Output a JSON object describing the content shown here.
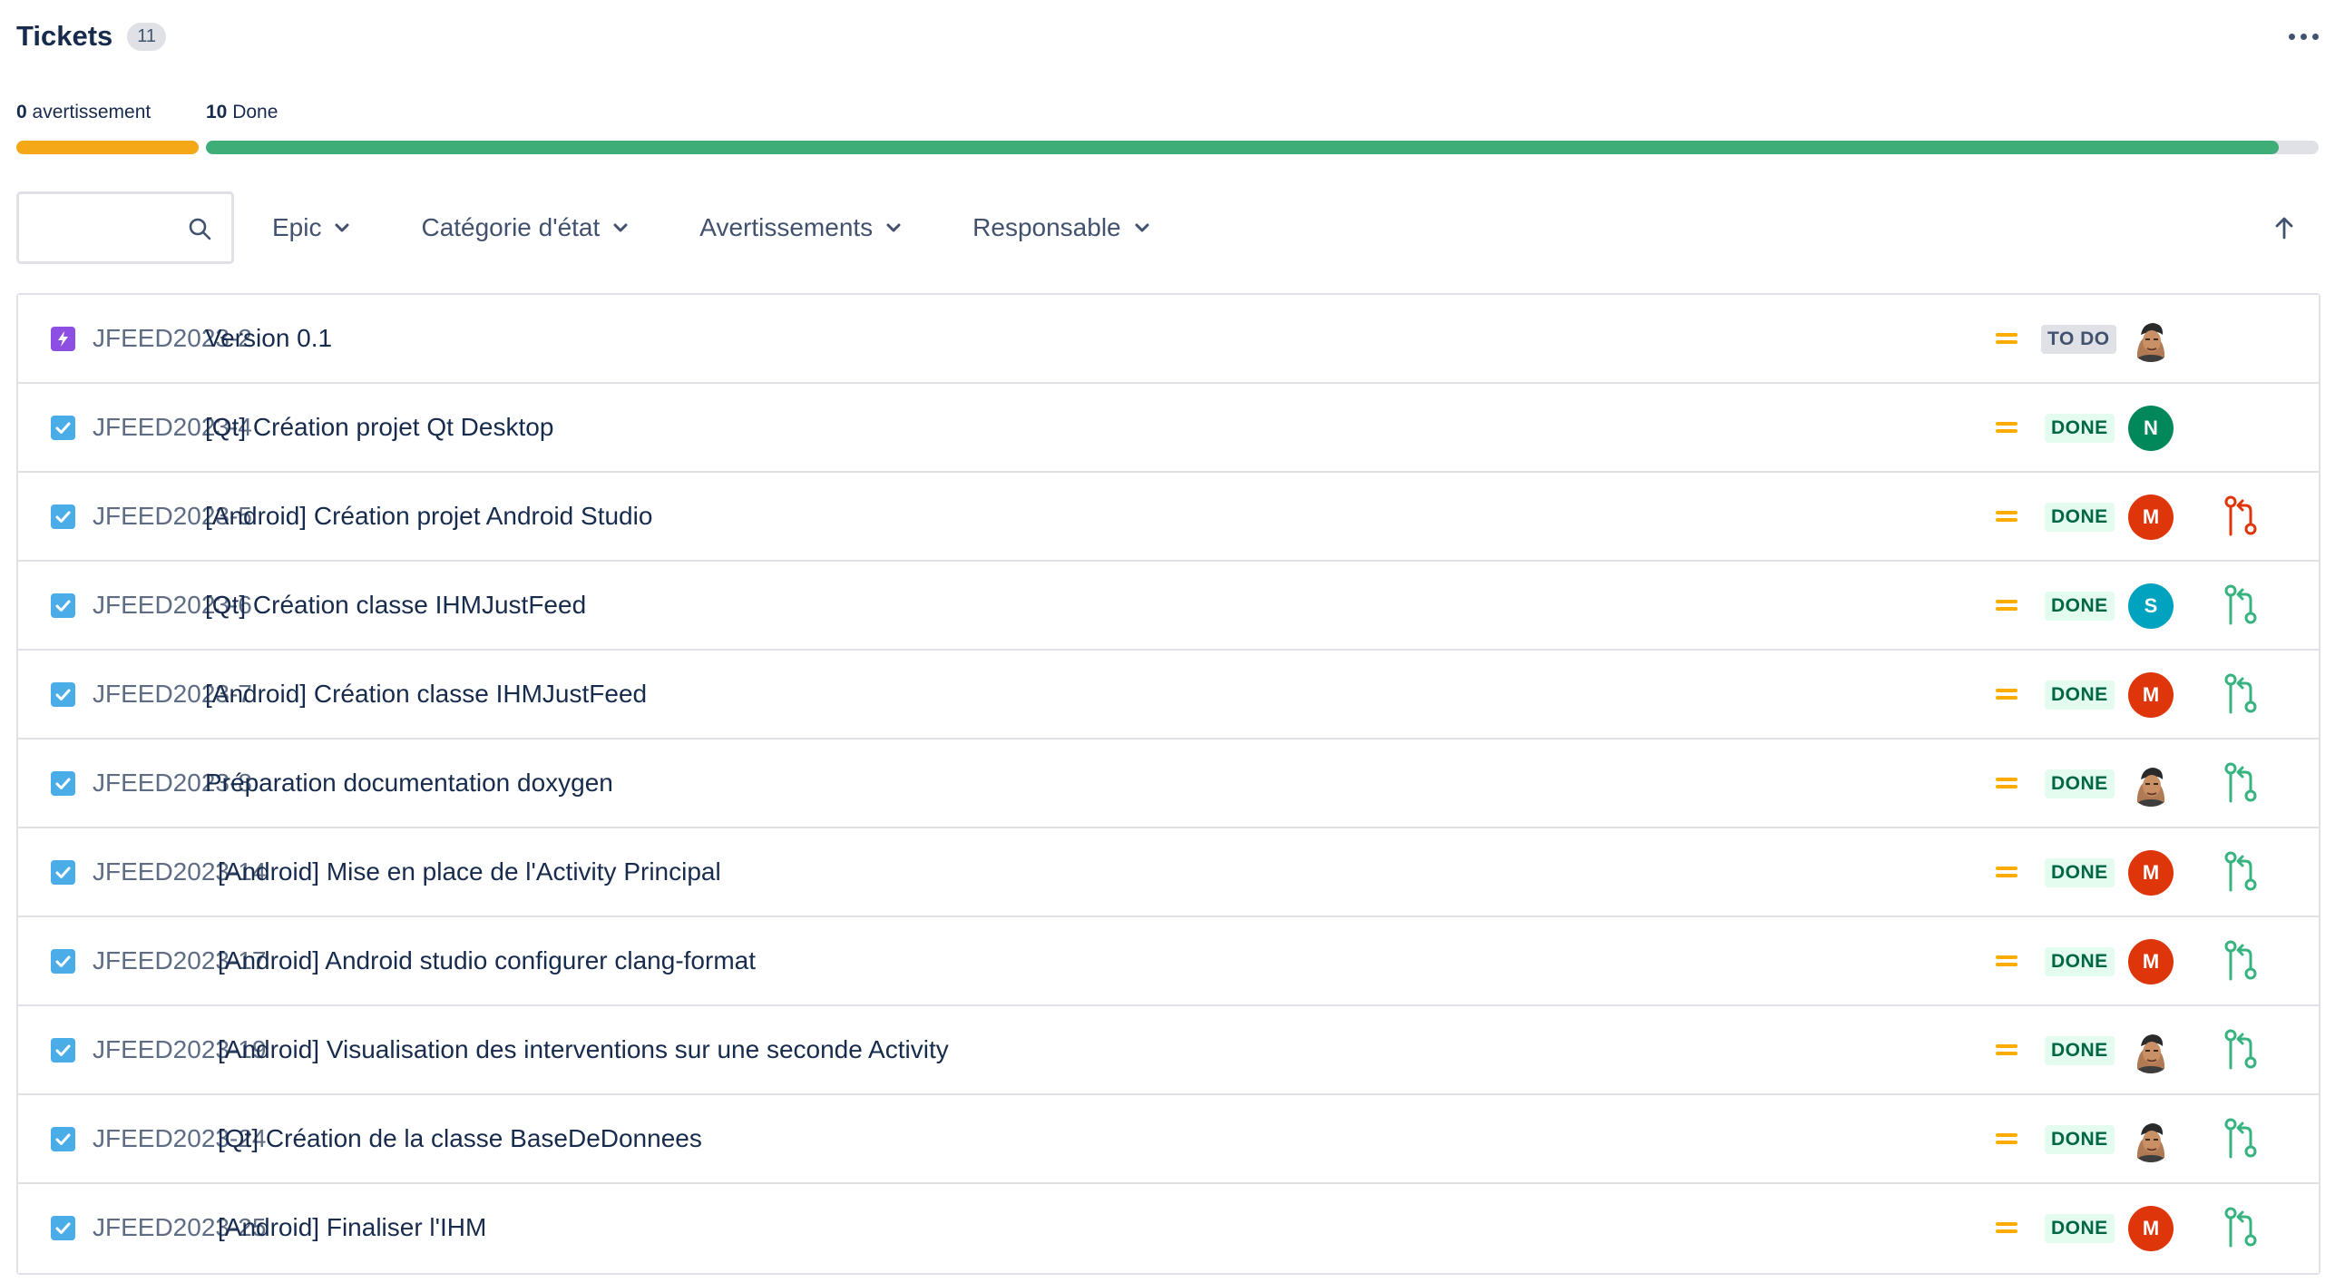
{
  "header": {
    "title": "Tickets",
    "count": "11"
  },
  "progress": {
    "warning": {
      "count": "0",
      "label": " avertissement"
    },
    "done": {
      "count": "10",
      "label": " Done"
    },
    "done_fraction": 0.98
  },
  "search": {
    "placeholder": "",
    "value": ""
  },
  "filters": [
    "Epic",
    "Catégorie d'état",
    "Avertissements",
    "Responsable"
  ],
  "colors": {
    "warning": "#f4a818",
    "done": "#3fad78",
    "epic": "#8c4fe2",
    "task": "#4bade8",
    "priority_medium": "#ffab00",
    "pr_open": "#de350b",
    "pr_merged": "#36b37e",
    "avatar_N": "#00875a",
    "avatar_M": "#de350b",
    "avatar_S": "#00a3bf"
  },
  "tickets": [
    {
      "key": "JFEED2023-2",
      "summary": "Version 0.1",
      "type_icon": "epic-icon",
      "priority": "medium-priority-icon",
      "status": "TO DO",
      "assignee": "photo",
      "pr": "none"
    },
    {
      "key": "JFEED2023-4",
      "summary": "[Qt] Création projet Qt Desktop",
      "type_icon": "task-icon",
      "priority": "medium-priority-icon",
      "status": "DONE",
      "assignee": "N",
      "pr": "none"
    },
    {
      "key": "JFEED2023-5",
      "summary": "[Android] Création projet Android Studio",
      "type_icon": "task-icon",
      "priority": "medium-priority-icon",
      "status": "DONE",
      "assignee": "M",
      "pr": "open"
    },
    {
      "key": "JFEED2023-6",
      "summary": "[Qt] Création classe IHMJustFeed",
      "type_icon": "task-icon",
      "priority": "medium-priority-icon",
      "status": "DONE",
      "assignee": "S",
      "pr": "merged"
    },
    {
      "key": "JFEED2023-7",
      "summary": "[Android] Création classe IHMJustFeed",
      "type_icon": "task-icon",
      "priority": "medium-priority-icon",
      "status": "DONE",
      "assignee": "M",
      "pr": "merged"
    },
    {
      "key": "JFEED2023-8",
      "summary": "Préparation documentation doxygen",
      "type_icon": "task-icon",
      "priority": "medium-priority-icon",
      "status": "DONE",
      "assignee": "photo",
      "pr": "merged"
    },
    {
      "key": "JFEED2023-14",
      "summary": "[Android] Mise en place de l'Activity Principal",
      "type_icon": "task-icon",
      "priority": "medium-priority-icon",
      "status": "DONE",
      "assignee": "M",
      "pr": "merged"
    },
    {
      "key": "JFEED2023-17",
      "summary": "[Android] Android studio configurer clang-format",
      "type_icon": "task-icon",
      "priority": "medium-priority-icon",
      "status": "DONE",
      "assignee": "M",
      "pr": "merged"
    },
    {
      "key": "JFEED2023-19",
      "summary": "[Android] Visualisation des interventions sur une seconde Activity",
      "type_icon": "task-icon",
      "priority": "medium-priority-icon",
      "status": "DONE",
      "assignee": "photo",
      "pr": "merged"
    },
    {
      "key": "JFEED2023-24",
      "summary": "[Qt] Création de la classe BaseDeDonnees",
      "type_icon": "task-icon",
      "priority": "medium-priority-icon",
      "status": "DONE",
      "assignee": "photo",
      "pr": "merged"
    },
    {
      "key": "JFEED2023-25",
      "summary": "[Android] Finaliser l'IHM",
      "type_icon": "task-icon",
      "priority": "medium-priority-icon",
      "status": "DONE",
      "assignee": "M",
      "pr": "merged"
    }
  ]
}
